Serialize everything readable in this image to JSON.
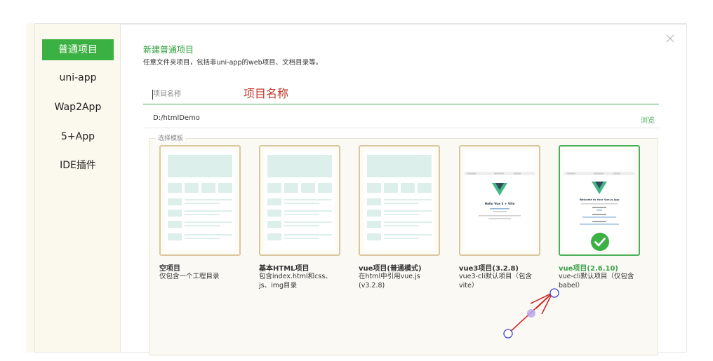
{
  "sidebar": {
    "items": [
      {
        "label": "普通项目",
        "active": true
      },
      {
        "label": "uni-app",
        "active": false
      },
      {
        "label": "Wap2App",
        "active": false
      },
      {
        "label": "5+App",
        "active": false
      },
      {
        "label": "IDE插件",
        "active": false
      }
    ]
  },
  "dialog": {
    "title": "新建普通项目",
    "subtitle": "任意文件夹项目，包括非uni-app的web项目、文档目录等。",
    "name_placeholder": "项目名称",
    "name_annotation": "项目名称",
    "path_value": "D:/htmlDemo",
    "browse_label": "浏览",
    "template_section_label": "选择模板"
  },
  "templates": [
    {
      "name": "空项目",
      "desc": "仅包含一个工程目录",
      "kind": "wire"
    },
    {
      "name": "基本HTML项目",
      "desc": "包含index.html和css、js、img目录",
      "kind": "wire"
    },
    {
      "name": "vue项目(普通模式)",
      "desc": "在html中引用vue.js (v3.2.8)",
      "kind": "wire"
    },
    {
      "name": "vue3项目(3.2.8)",
      "desc": "vue3-cli默认项目（包含vite）",
      "kind": "vue",
      "preview_text": "Hello Vue 3 + Vite"
    },
    {
      "name": "vue项目(2.6.10)",
      "desc": "vue-cli默认项目（仅包含babel）",
      "kind": "vue",
      "preview_text": "Welcome to Your Vue.js App",
      "selected": true
    }
  ],
  "colors": {
    "accent_green": "#3cb143",
    "card_border": "#d9c89e",
    "annotation_red": "#c0392b",
    "wire_fill": "#dcefeb"
  }
}
